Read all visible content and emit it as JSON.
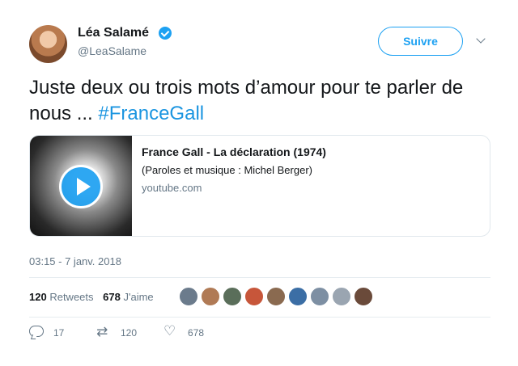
{
  "author": {
    "name": "Léa Salamé",
    "handle": "@LeaSalame",
    "verified": true
  },
  "follow_button": {
    "label": "Suivre"
  },
  "tweet": {
    "text": "Juste deux ou trois mots d’amour pour te parler de nous ... ",
    "hashtag": "#FranceGall"
  },
  "card": {
    "title": "France Gall - La déclaration (1974)",
    "description": "(Paroles et musique : Michel Berger)",
    "domain": "youtube.com"
  },
  "timestamp": "03:15 - 7 janv. 2018",
  "stats": {
    "retweets_count": "120",
    "retweets_label": "Retweets",
    "likes_count": "678",
    "likes_label": "J'aime"
  },
  "likers": [
    {
      "color": "#6b7b8c"
    },
    {
      "color": "#b07a55"
    },
    {
      "color": "#5a6e5a"
    },
    {
      "color": "#c7563a"
    },
    {
      "color": "#8a6a50"
    },
    {
      "color": "#3b6ea5"
    },
    {
      "color": "#7d8fa3"
    },
    {
      "color": "#9aa5b1"
    },
    {
      "color": "#6a4a3a"
    }
  ],
  "actions": {
    "replies": "17",
    "retweets": "120",
    "likes": "678"
  },
  "colors": {
    "accent": "#1da1f2",
    "text": "#14171a",
    "muted": "#657786",
    "border": "#e1e8ed"
  }
}
